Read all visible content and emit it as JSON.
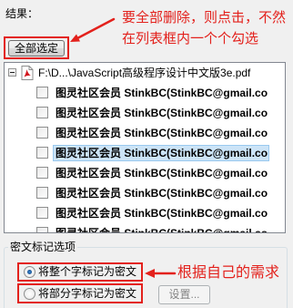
{
  "results_label": "结果：",
  "select_all_button": {
    "label": "全部选定"
  },
  "annotations": {
    "top": {
      "lines": [
        "要全部删除，则点击，不然",
        "在列表框内一个个勾选"
      ]
    },
    "bottom": {
      "text": "根据自己的需求"
    }
  },
  "tree": {
    "root": {
      "label": "F:\\D...\\JavaScript高级程序设计中文版3e.pdf",
      "expanded": true,
      "expander_icon": "minus-box-icon",
      "file_icon": "pdf-file-icon"
    },
    "items": [
      {
        "label": "图灵社区会员 StinkBC(StinkBC@gmail.co",
        "checked": false,
        "selected": false
      },
      {
        "label": "图灵社区会员 StinkBC(StinkBC@gmail.co",
        "checked": false,
        "selected": false
      },
      {
        "label": "图灵社区会员 StinkBC(StinkBC@gmail.co",
        "checked": false,
        "selected": false
      },
      {
        "label": "图灵社区会员 StinkBC(StinkBC@gmail.co",
        "checked": false,
        "selected": true
      },
      {
        "label": "图灵社区会员 StinkBC(StinkBC@gmail.co",
        "checked": false,
        "selected": false
      },
      {
        "label": "图灵社区会员 StinkBC(StinkBC@gmail.co",
        "checked": false,
        "selected": false
      },
      {
        "label": "图灵社区会员 StinkBC(StinkBC@gmail.co",
        "checked": false,
        "selected": false
      },
      {
        "label": "图灵社区会员 StinkBC(StinkBC@gmail.co",
        "checked": false,
        "selected": false
      }
    ]
  },
  "markup_options": {
    "group_label": "密文标记选项",
    "options": [
      {
        "label": "将整个字标记为密文",
        "selected": true
      },
      {
        "label": "将部分字标记为密文",
        "selected": false
      }
    ],
    "settings_button": {
      "label": "设置...",
      "enabled": false
    }
  },
  "colors": {
    "annotation": "#e3211c",
    "selection": "#cce4f7",
    "selection_border": "#99c9ef",
    "background": "#f0f0f0"
  }
}
